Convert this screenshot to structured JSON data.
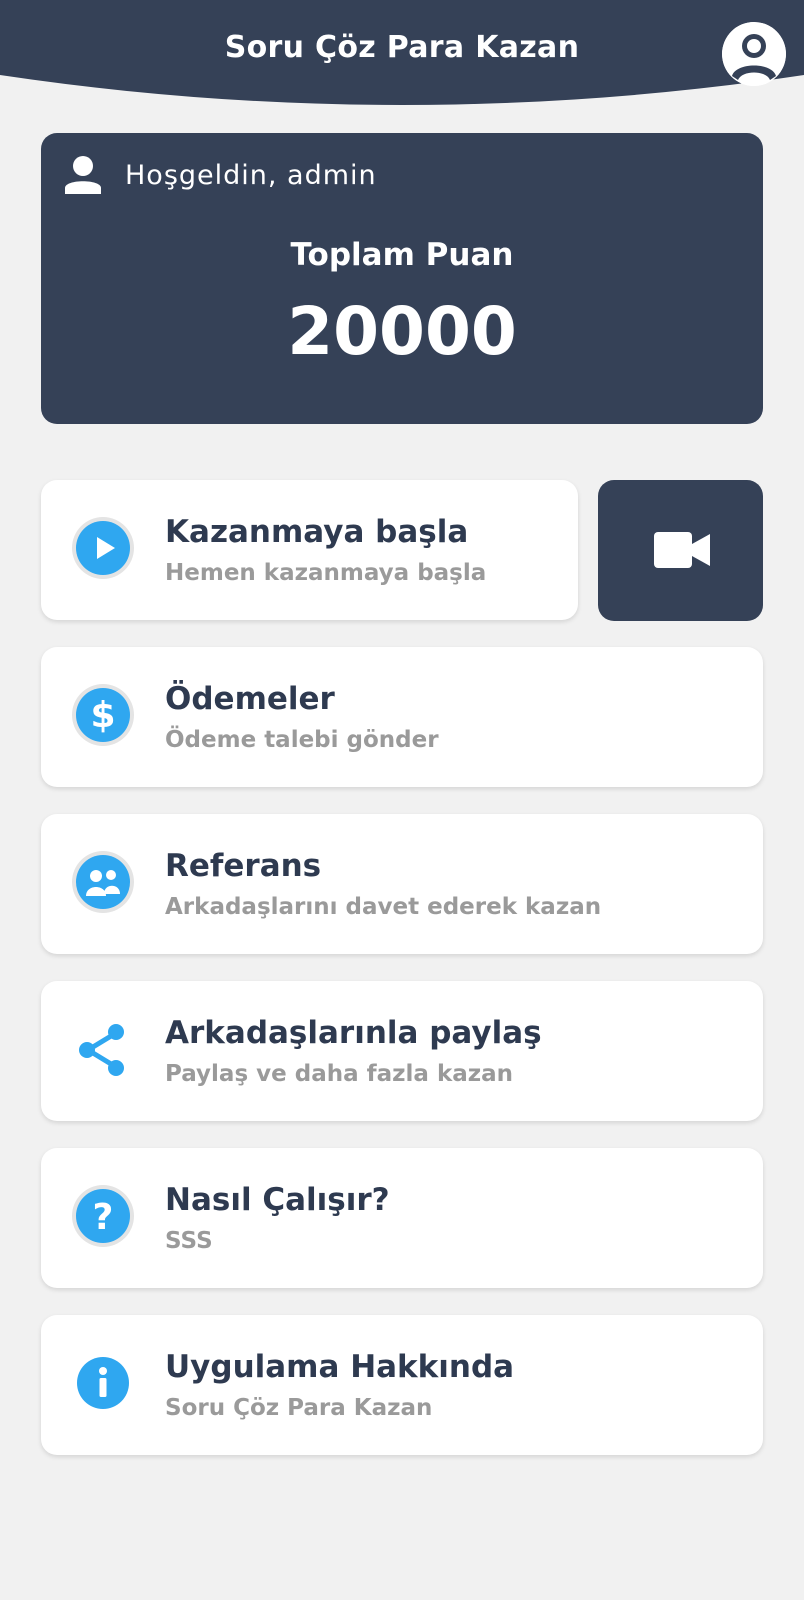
{
  "header": {
    "title": "Soru Çöz Para Kazan",
    "profile_icon": "account-circle-icon",
    "background_color": "#354157"
  },
  "score_card": {
    "welcome": "Hoşgeldin, admin",
    "user_icon": "user-icon",
    "label": "Toplam Puan",
    "value": "20000"
  },
  "video_button": {
    "icon": "video-camera-icon"
  },
  "menu": [
    {
      "title": "Kazanmaya başla",
      "subtitle": "Hemen kazanmaya başla",
      "icon": "play-icon"
    },
    {
      "title": "Ödemeler",
      "subtitle": "Ödeme talebi gönder",
      "icon": "dollar-icon"
    },
    {
      "title": "Referans",
      "subtitle": "Arkadaşlarını davet ederek kazan",
      "icon": "people-icon"
    },
    {
      "title": "Arkadaşlarınla paylaş",
      "subtitle": "Paylaş ve daha fazla kazan",
      "icon": "share-icon"
    },
    {
      "title": "Nasıl Çalışır?",
      "subtitle": "SSS",
      "icon": "question-icon"
    },
    {
      "title": "Uygulama Hakkında",
      "subtitle": "Soru Çöz Para Kazan",
      "icon": "info-icon"
    }
  ],
  "colors": {
    "accent": "#2fa7f0",
    "card_dark": "#354157",
    "page_background": "#f1f1f1",
    "subtitle_gray": "#9a9a9a"
  }
}
